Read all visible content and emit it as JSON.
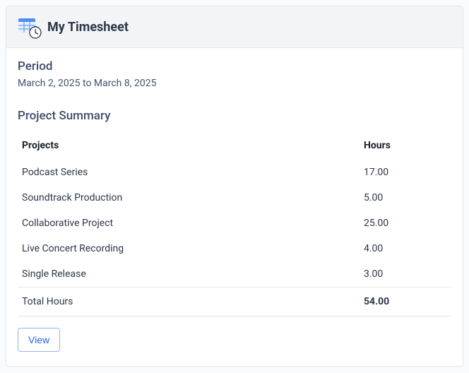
{
  "header": {
    "title": "My Timesheet"
  },
  "period": {
    "label": "Period",
    "value": "March 2, 2025 to March 8, 2025"
  },
  "summary": {
    "title": "Project Summary",
    "columns": {
      "projects": "Projects",
      "hours": "Hours"
    },
    "rows": [
      {
        "name": "Podcast Series",
        "hours": "17.00"
      },
      {
        "name": "Soundtrack Production",
        "hours": "5.00"
      },
      {
        "name": "Collaborative Project",
        "hours": "25.00"
      },
      {
        "name": "Live Concert Recording",
        "hours": "4.00"
      },
      {
        "name": "Single Release",
        "hours": "3.00"
      }
    ],
    "total": {
      "label": "Total Hours",
      "value": "54.00"
    }
  },
  "actions": {
    "view": "View"
  }
}
